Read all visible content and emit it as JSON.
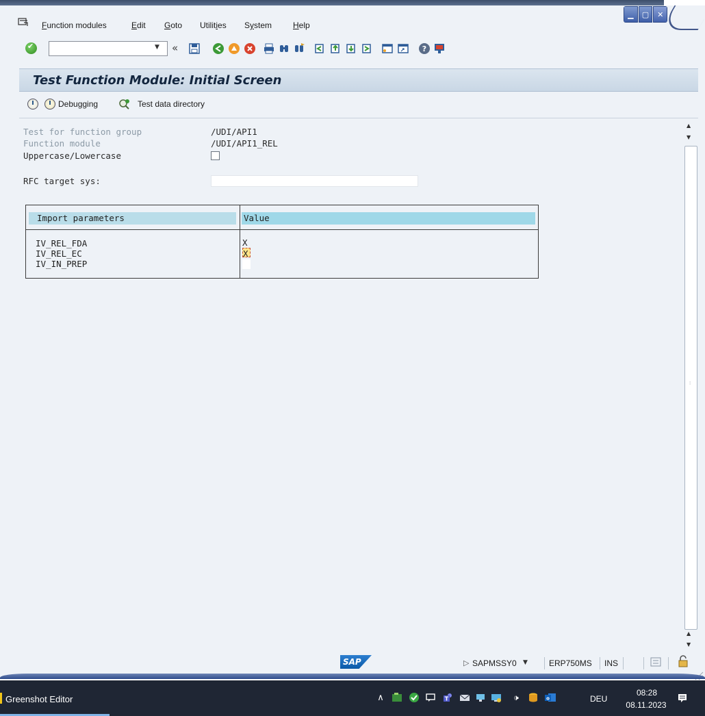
{
  "menu": {
    "items": [
      {
        "mnemonic": "F",
        "rest": "unction modules"
      },
      {
        "mnemonic": "E",
        "rest": "dit"
      },
      {
        "mnemonic": "G",
        "rest": "oto"
      },
      {
        "pre": "Utilit",
        "mnemonic": "i",
        "rest": "es"
      },
      {
        "pre": "S",
        "mnemonic": "y",
        "rest": "stem"
      },
      {
        "mnemonic": "H",
        "rest": "elp"
      }
    ]
  },
  "toolbar": {
    "command_value": "",
    "collapse_glyph": "«",
    "icons": [
      "enter-icon",
      "command-field",
      "save-icon",
      "back-icon",
      "exit-icon",
      "cancel-icon",
      "print-icon",
      "find-icon",
      "find-next-icon",
      "first-page-icon",
      "previous-page-icon",
      "next-page-icon",
      "last-page-icon",
      "create-session-icon",
      "shortcut-icon",
      "help-icon",
      "layout-icon"
    ]
  },
  "title": "Test Function Module: Initial Screen",
  "app_toolbar": {
    "execute_icon": "execute-clock-icon",
    "debugging_label": "Debugging",
    "test_data_label": "Test data directory"
  },
  "fields": {
    "function_group_label": "Test for function group",
    "function_group_value": "/UDI/API1",
    "function_module_label": "Function module",
    "function_module_value": "/UDI/API1_REL",
    "case_label": "Uppercase/Lowercase",
    "case_checked": false,
    "rfc_label": "RFC target sys:",
    "rfc_value": ""
  },
  "params": {
    "headers": [
      "Import parameters",
      "Value"
    ],
    "rows": [
      {
        "name": "IV_REL_FDA",
        "value": "X"
      },
      {
        "name": "IV_REL_EC",
        "value": "X"
      },
      {
        "name": "IV_IN_PREP",
        "value": ""
      }
    ]
  },
  "status": {
    "logo": "SAP",
    "program": "SAPMSSY0",
    "server": "ERP750MS",
    "mode": "INS"
  },
  "taskbar": {
    "app": "Greenshot Editor",
    "language": "DEU",
    "time": "08:28",
    "date": "08.11.2023"
  },
  "colors": {
    "frame_blue": "#3d5ea8",
    "title_bar": "#c9d7e5",
    "content_bg": "#eef2f7",
    "header_cyan": "#9fd8e8",
    "taskbar": "#1f2634"
  }
}
